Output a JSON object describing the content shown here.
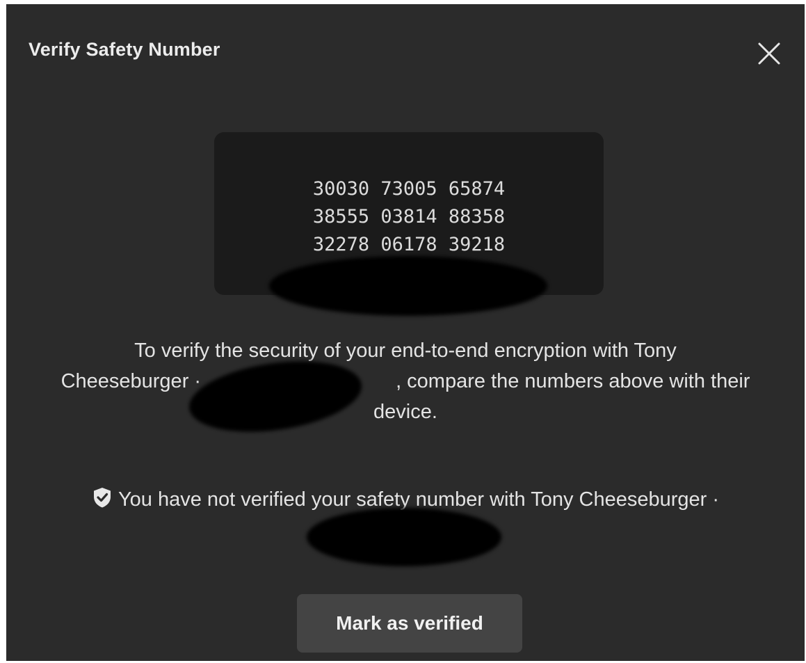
{
  "dialog": {
    "title": "Verify Safety Number",
    "close_icon": "close-icon"
  },
  "safety_number": {
    "rows": [
      "30030 73005 65874",
      "38555 03814 88358",
      "32278 06178 39218"
    ]
  },
  "description": {
    "line1": "To verify the security of your end-to-end encryption with Tony",
    "line2_prefix": "Cheeseburger ·",
    "line2_suffix": ", compare the numbers above with their",
    "line3": "device."
  },
  "status": {
    "icon": "shield-check-icon",
    "text": "You have not verified your safety number with Tony Cheeseburger ·"
  },
  "actions": {
    "mark_verified_label": "Mark as verified"
  },
  "colors": {
    "dialog_bg": "#2b2b2b",
    "number_box_bg": "#1b1b1b",
    "button_bg": "#444444",
    "text": "#e4e4e4"
  }
}
